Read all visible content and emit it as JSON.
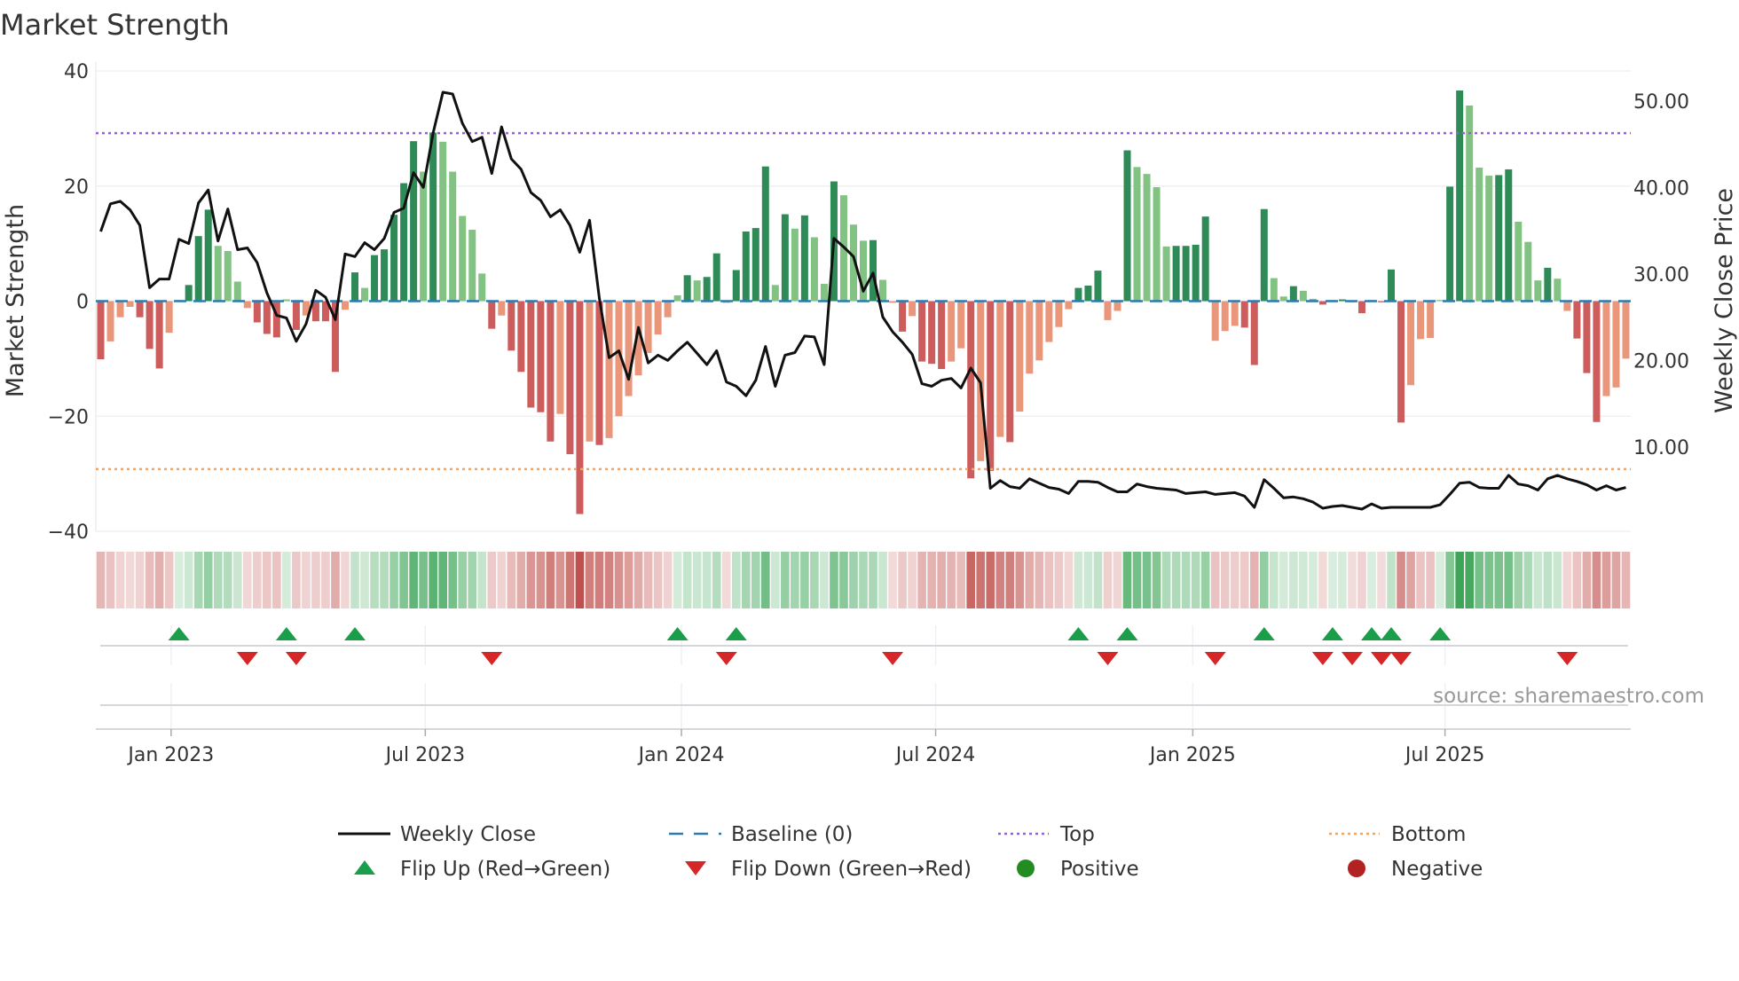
{
  "chart_data": {
    "type": "bar",
    "title": "Market Strength",
    "ylabel": "Market Strength",
    "ylabel_right": "Weekly Close Price",
    "ylim": [
      -40,
      40
    ],
    "ylim_right": [
      0.3,
      53.5
    ],
    "yticks": [
      "40",
      "20",
      "0",
      "−20",
      "−40"
    ],
    "yticks_values": [
      40,
      20,
      0,
      -20,
      -40
    ],
    "yticks_right": [
      "50.00",
      "40.00",
      "30.00",
      "20.00",
      "10.00"
    ],
    "yticks_right_values": [
      50,
      40,
      30,
      20,
      10
    ],
    "x_start_week": "2022-11-12",
    "x_interval": "weekly",
    "xticks": [
      {
        "label": "Jan 2023",
        "week": 7.2
      },
      {
        "label": "Jul 2023",
        "week": 33.2
      },
      {
        "label": "Jan 2024",
        "week": 59.4
      },
      {
        "label": "Jul 2024",
        "week": 85.4
      },
      {
        "label": "Jan 2025",
        "week": 111.7
      },
      {
        "label": "Jul 2025",
        "week": 137.5
      }
    ],
    "top_level": 29.2,
    "bottom_level": -29.2,
    "baseline": 0,
    "series": [
      {
        "name": "Market Strength",
        "type": "bar",
        "values": [
          -10.1,
          -7,
          -2.8,
          -1,
          -2.8,
          -8.3,
          -11.7,
          -5.5,
          0.2,
          2.8,
          11.3,
          15.9,
          9.6,
          8.7,
          3.4,
          -1.2,
          -3.7,
          -5.7,
          -6.3,
          0.3,
          -5,
          -2.5,
          -3.5,
          -3.5,
          -12.3,
          -1.5,
          5,
          2.3,
          8,
          9,
          15,
          20.5,
          27.8,
          22.5,
          29.3,
          27.7,
          22.5,
          14.8,
          12.4,
          4.8,
          -4.8,
          -2.5,
          -8.6,
          -12.3,
          -18.5,
          -19.3,
          -24.4,
          -19.6,
          -26.6,
          -37,
          -24.4,
          -25,
          -23.8,
          -20,
          -16.5,
          -12.9,
          -9,
          -5.8,
          -2.8,
          1,
          4.5,
          3.6,
          4.2,
          8.3,
          -0.3,
          5.4,
          12.1,
          12.7,
          23.4,
          2.8,
          15.1,
          12.6,
          14.9,
          11.1,
          3,
          20.8,
          18.4,
          13.3,
          10.5,
          10.6,
          3.7,
          -0.3,
          -5.3,
          -2.6,
          -10.5,
          -10.9,
          -11.8,
          -10.5,
          -8.2,
          -30.8,
          -27.8,
          -29.5,
          -23.6,
          -24.5,
          -19.2,
          -12.6,
          -10.3,
          -7.1,
          -4.5,
          -1.4,
          2.3,
          2.7,
          5.3,
          -3.3,
          -1.7,
          26.2,
          23.3,
          22.1,
          19.8,
          9.5,
          9.6,
          9.6,
          9.8,
          14.7,
          -6.9,
          -5.2,
          -4.3,
          -4.6,
          -11.1,
          16,
          4,
          0.8,
          2.6,
          1.8,
          0.4,
          -0.6,
          0.2,
          0.3,
          -0.2,
          -2.1,
          0.2,
          -0.2,
          5.5,
          -21.1,
          -14.6,
          -6.6,
          -6.4,
          0.2,
          19.9,
          36.6,
          34,
          23.2,
          21.8,
          21.9,
          22.9,
          13.8,
          10.3,
          3.6,
          5.8,
          3.9,
          -1.7,
          -6.5,
          -12.5,
          -21,
          -16.5,
          -15,
          -10
        ]
      },
      {
        "name": "Weekly Close",
        "type": "line",
        "axis": "right",
        "values": [
          34.9,
          38.1,
          38.4,
          37.4,
          35.6,
          28.4,
          29.4,
          29.4,
          34.0,
          33.5,
          38.2,
          39.7,
          33.8,
          37.5,
          32.8,
          33.0,
          31.3,
          27.8,
          25.2,
          24.9,
          22.2,
          24.2,
          28.1,
          27.3,
          24.7,
          32.3,
          32.0,
          33.6,
          32.8,
          34.1,
          37.1,
          37.6,
          41.7,
          40.0,
          46.3,
          51.0,
          50.8,
          47.4,
          45.3,
          45.8,
          41.6,
          47.0,
          43.3,
          42.1,
          39.4,
          38.5,
          36.6,
          37.4,
          35.6,
          32.5,
          36.2,
          27.2,
          20.3,
          21.1,
          17.8,
          23.8,
          19.7,
          20.6,
          20.0,
          21.1,
          22.1,
          20.8,
          19.5,
          21.1,
          17.5,
          17.0,
          15.9,
          17.7,
          21.6,
          17.0,
          20.6,
          20.9,
          22.8,
          22.7,
          19.5,
          34.1,
          33.1,
          32.0,
          28.0,
          30.1,
          25.0,
          23.3,
          22.1,
          20.7,
          17.3,
          17.0,
          17.7,
          17.9,
          16.8,
          19.1,
          17.4,
          5.2,
          6.1,
          5.4,
          5.2,
          6.3,
          5.8,
          5.3,
          5.1,
          4.6,
          6.0,
          6.0,
          5.9,
          5.3,
          4.8,
          4.8,
          5.7,
          5.4,
          5.2,
          5.1,
          5.0,
          4.6,
          4.7,
          4.8,
          4.5,
          4.6,
          4.7,
          4.3,
          3.0,
          6.2,
          5.2,
          4.1,
          4.2,
          4.0,
          3.6,
          2.9,
          3.1,
          3.2,
          3.0,
          2.8,
          3.4,
          2.9,
          3.0,
          3.0,
          3.0,
          3.0,
          3.0,
          3.3,
          4.5,
          5.8,
          5.9,
          5.3,
          5.2,
          5.2,
          6.7,
          5.7,
          5.5,
          5.0,
          6.3,
          6.7,
          6.3,
          6.0,
          5.6,
          5.0,
          5.5,
          5.0,
          5.3
        ]
      }
    ],
    "flip_up_weeks": [
      8,
      19,
      26,
      59,
      65,
      100,
      105,
      119,
      126,
      130,
      132,
      137
    ],
    "flip_down_weeks": [
      15,
      20,
      40,
      64,
      81,
      103,
      114,
      125,
      128,
      131,
      133,
      150
    ],
    "colors": {
      "strong_positive": "#2e8b57",
      "weak_positive": "#82c282",
      "strong_negative": "#cd5c5c",
      "weak_negative": "#e9967a",
      "heat_positive": "#3aa455",
      "heat_negative": "#c0504d",
      "line": "#111111",
      "baseline": "#2b7bb0",
      "top": "#9b5fd6",
      "bottom": "#f4a460",
      "flip_up": "#1a9e4a",
      "flip_down": "#d62728",
      "positive_dot": "#228b22",
      "negative_dot": "#b22222"
    },
    "legend": {
      "placement": "bottom",
      "items": [
        {
          "label": "Weekly Close",
          "kind": "line"
        },
        {
          "label": "Baseline (0)",
          "kind": "dash"
        },
        {
          "label": "Top",
          "kind": "dot-top"
        },
        {
          "label": "Bottom",
          "kind": "dot-bottom"
        },
        {
          "label": "Flip Up (Red→Green)",
          "kind": "tri-up"
        },
        {
          "label": "Flip Down (Green→Red)",
          "kind": "tri-down"
        },
        {
          "label": "Positive",
          "kind": "circle-pos"
        },
        {
          "label": "Negative",
          "kind": "circle-neg"
        }
      ]
    },
    "source": "source: sharemaestro.com"
  }
}
